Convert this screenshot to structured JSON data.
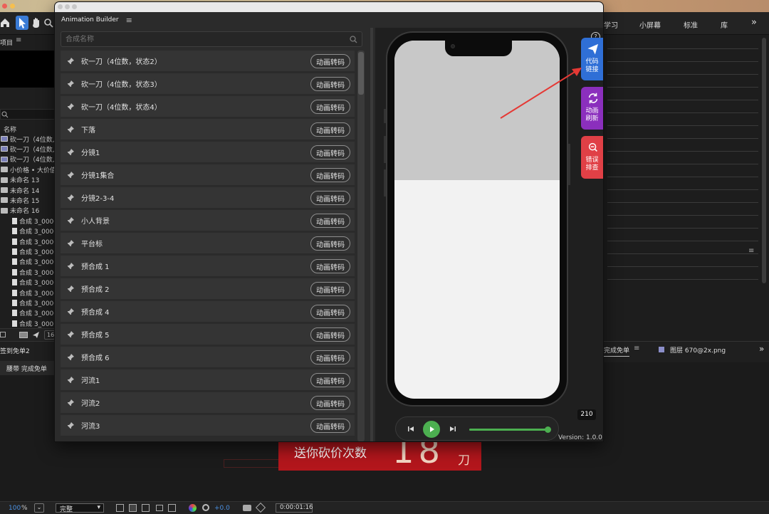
{
  "host": {
    "workspaces": [
      "学习",
      "小屏幕",
      "标准",
      "库"
    ],
    "project_label": "项目",
    "name_col": "名称",
    "project_items": [
      {
        "label": "砍一刀（4位数,",
        "type": "comp"
      },
      {
        "label": "砍一刀（4位数,",
        "type": "comp"
      },
      {
        "label": "砍一刀（4位数,",
        "type": "comp"
      },
      {
        "label": "小价格 • 大价值",
        "type": "folder"
      },
      {
        "label": "未命名 13",
        "type": "folder"
      },
      {
        "label": "未命名 14",
        "type": "folder"
      },
      {
        "label": "未命名 15",
        "type": "folder"
      },
      {
        "label": "未命名 16",
        "type": "folder"
      },
      {
        "label": "合成 3_0000",
        "type": "file"
      },
      {
        "label": "合成 3_0000",
        "type": "file"
      },
      {
        "label": "合成 3_0000",
        "type": "file"
      },
      {
        "label": "合成 3_0000",
        "type": "file"
      },
      {
        "label": "合成 3_0000",
        "type": "file"
      },
      {
        "label": "合成 3_0000",
        "type": "file"
      },
      {
        "label": "合成 3_0000",
        "type": "file"
      },
      {
        "label": "合成 3_0000",
        "type": "file"
      },
      {
        "label": "合成 3_0000",
        "type": "file"
      },
      {
        "label": "合成 3_0000",
        "type": "file"
      },
      {
        "label": "合成 3_0001",
        "type": "file"
      }
    ],
    "timeline_tab": "签到免单2",
    "timeline_subtab": "腰带 完成免单",
    "right_tab": "完成免单",
    "layer_file": "图层 670@2x.png",
    "frame_count": "16",
    "canvas_text": "送你砍价次数",
    "canvas_big": "18",
    "canvas_unit": "刀",
    "bottom": {
      "zoom": "100",
      "zoom_unit": "%",
      "quality": "完整",
      "exposure": "+0.0",
      "timecode": "0:00:01:16"
    }
  },
  "panel": {
    "title": "Animation Builder",
    "search_placeholder": "合成名称",
    "convert_label": "动画转码",
    "items": [
      "砍一刀（4位数，状态2）",
      "砍一刀（4位数，状态3）",
      "砍一刀（4位数，状态4）",
      "下落",
      "分镜1",
      "分镜1集合",
      "分镜2-3-4",
      "小人背景",
      "平台标",
      "预合成 1",
      "预合成 2",
      "预合成 4",
      "预合成 5",
      "预合成 6",
      "河流1",
      "河流2",
      "河流3"
    ],
    "side_buttons": [
      {
        "label1": "代码",
        "label2": "链接",
        "color": "#2f6fd6",
        "icon": "paper-plane-icon"
      },
      {
        "label1": "动画",
        "label2": "刷新",
        "color": "#8b2fbd",
        "icon": "refresh-icon"
      },
      {
        "label1": "错误",
        "label2": "排查",
        "color": "#e04046",
        "icon": "zoom-out-icon"
      }
    ],
    "help_glyph": "?",
    "frame_badge": "210",
    "progress": 1.0,
    "version": "Version: 1.0.0",
    "accent": "#4caf50"
  }
}
